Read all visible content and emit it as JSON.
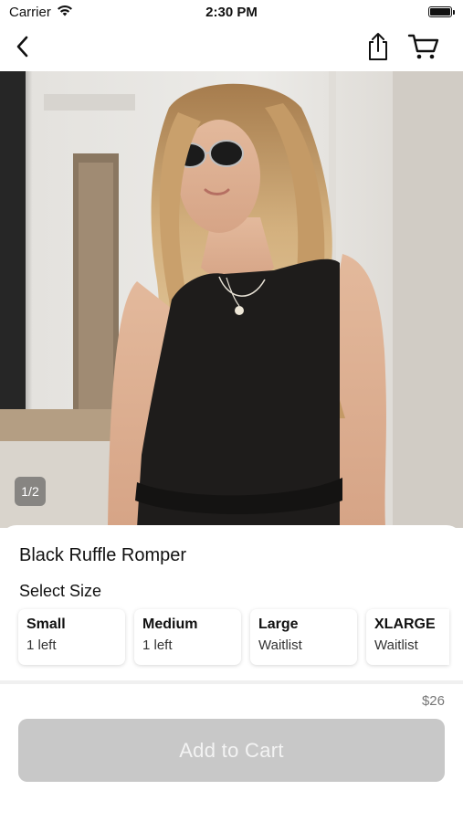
{
  "status_bar": {
    "carrier": "Carrier",
    "time": "2:30 PM"
  },
  "nav": {
    "back_icon": "chevron-left-icon",
    "share_icon": "share-icon",
    "cart_icon": "shopping-cart-icon"
  },
  "gallery": {
    "page_indicator": "1/2"
  },
  "product": {
    "title": "Black Ruffle Romper",
    "size_heading": "Select Size",
    "sizes": [
      {
        "name": "Small",
        "stock": "1 left"
      },
      {
        "name": "Medium",
        "stock": "1 left"
      },
      {
        "name": "Large",
        "stock": "Waitlist"
      },
      {
        "name": "XLARGE",
        "stock": "Waitlist"
      }
    ],
    "price": "$26",
    "add_to_cart_label": "Add to Cart"
  },
  "colors": {
    "cta_disabled": "#c8c8c8",
    "text": "#111111",
    "price": "#777777"
  }
}
